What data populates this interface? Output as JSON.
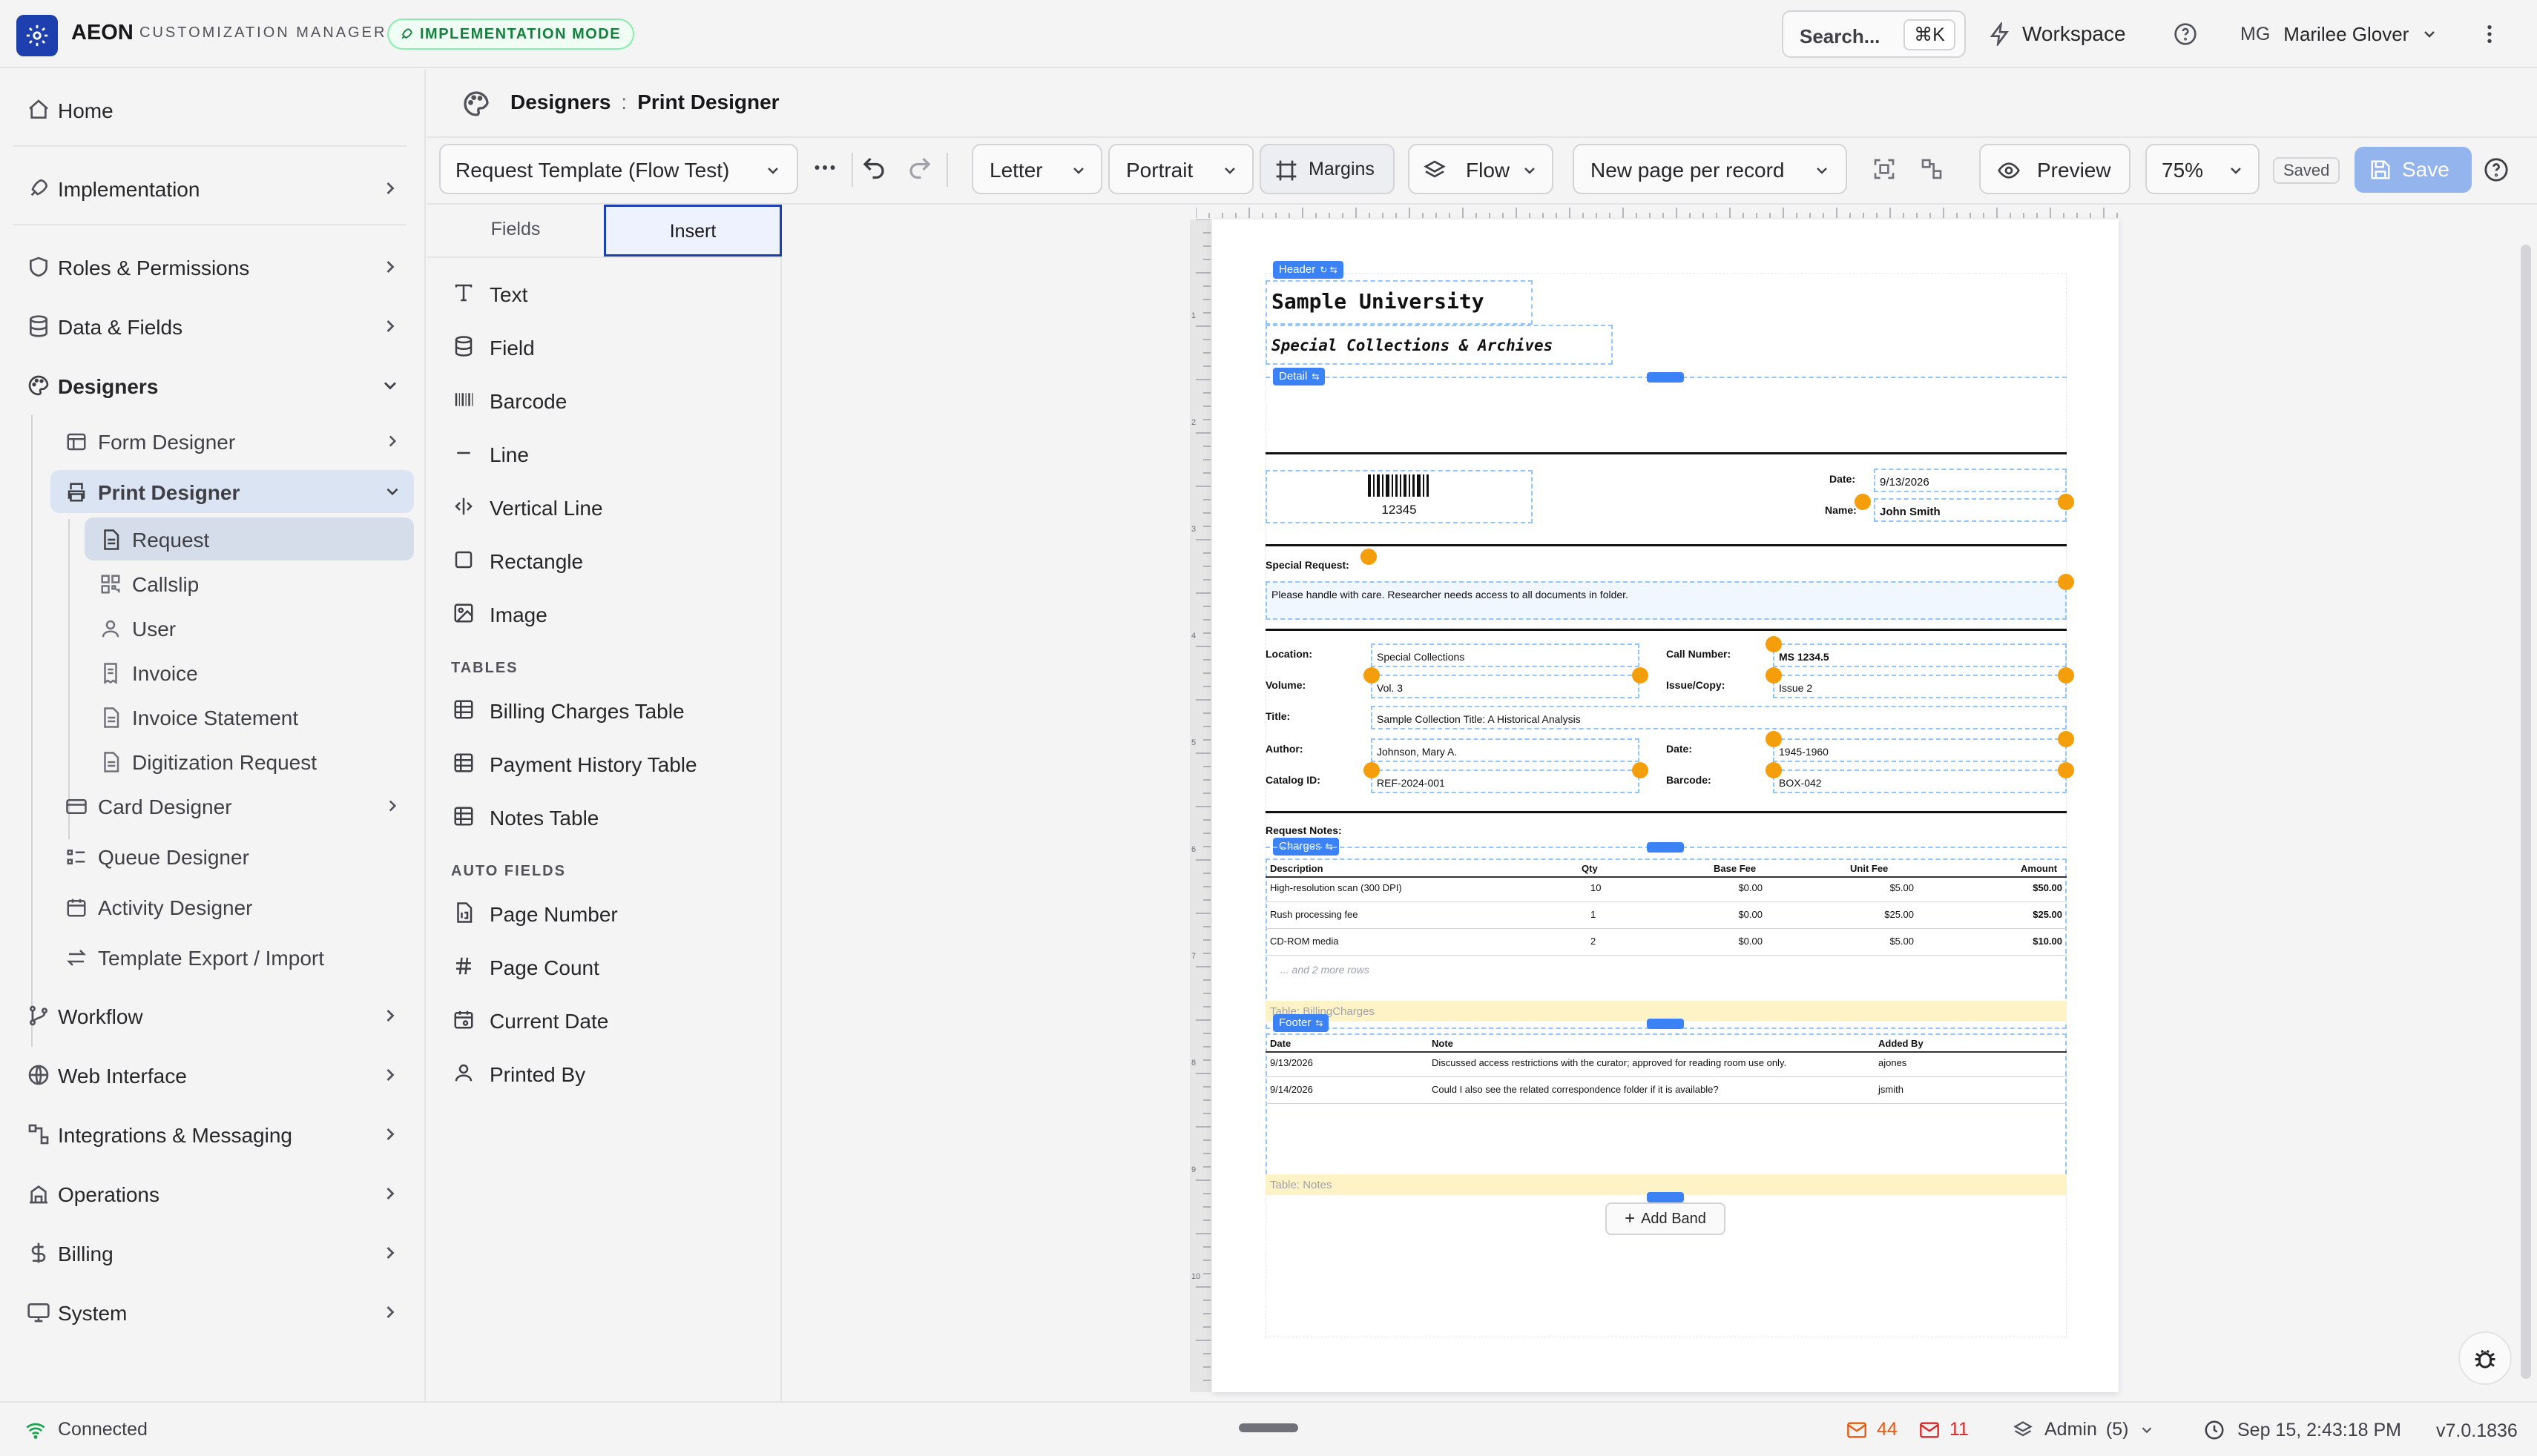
{
  "brand": {
    "name": "AEON",
    "subtitle": "CUSTOMIZATION MANAGER",
    "mode_badge": "IMPLEMENTATION MODE"
  },
  "topbar": {
    "search_label": "Search...",
    "search_shortcut": "⌘K",
    "workspace_label": "Workspace",
    "user_initials": "MG",
    "user_name": "Marilee Glover"
  },
  "sidebar": {
    "home": "Home",
    "implementation": "Implementation",
    "roles": "Roles & Permissions",
    "data_fields": "Data & Fields",
    "designers": "Designers",
    "form_designer": "Form Designer",
    "print_designer": "Print Designer",
    "print_items": [
      "Request",
      "Callslip",
      "User",
      "Invoice",
      "Invoice Statement",
      "Digitization Request"
    ],
    "card_designer": "Card Designer",
    "queue_designer": "Queue Designer",
    "activity_designer": "Activity Designer",
    "template_export": "Template Export / Import",
    "workflow": "Workflow",
    "web_interface": "Web Interface",
    "integrations": "Integrations & Messaging",
    "operations": "Operations",
    "billing": "Billing",
    "system": "System"
  },
  "breadcrumb": {
    "section": "Designers",
    "separator": ":",
    "page": "Print Designer"
  },
  "toolbar": {
    "template": "Request Template (Flow Test)",
    "paper": "Letter",
    "orientation": "Portrait",
    "margins": "Margins",
    "layout": "Flow",
    "paging": "New page per record",
    "preview": "Preview",
    "zoom": "75%",
    "saved_badge": "Saved",
    "save": "Save"
  },
  "panel": {
    "tabs": [
      "Fields",
      "Insert"
    ],
    "active_tab": "Insert",
    "basic_items": [
      "Text",
      "Field",
      "Barcode",
      "Line",
      "Vertical Line",
      "Rectangle",
      "Image"
    ],
    "tables_heading": "TABLES",
    "table_items": [
      "Billing Charges Table",
      "Payment History Table",
      "Notes Table"
    ],
    "auto_heading": "AUTO FIELDS",
    "auto_items": [
      "Page Number",
      "Page Count",
      "Current Date",
      "Printed By"
    ]
  },
  "ruler": {
    "marks": [
      "1",
      "2",
      "3",
      "4",
      "5",
      "6",
      "7",
      "8",
      "9",
      "10"
    ]
  },
  "document": {
    "bands": {
      "header": "Header",
      "detail": "Detail",
      "charges": "Charges",
      "footer": "Footer"
    },
    "title": "Sample University",
    "subtitle": "Special Collections & Archives",
    "barcode_value": "12345",
    "date_label": "Date:",
    "date_value": "9/13/2026",
    "name_label": "Name:",
    "name_value": "John Smith",
    "special_request_label": "Special Request:",
    "special_request_value": "Please handle with care. Researcher needs access to all documents in folder.",
    "fields": {
      "location_label": "Location:",
      "location_value": "Special Collections",
      "volume_label": "Volume:",
      "volume_value": "Vol. 3",
      "title_label": "Title:",
      "title_value": "Sample Collection Title: A Historical Analysis",
      "author_label": "Author:",
      "author_value": "Johnson, Mary A.",
      "catalog_label": "Catalog ID:",
      "catalog_value": "REF-2024-001",
      "call_label": "Call Number:",
      "call_value": "MS 1234.5",
      "issue_label": "Issue/Copy:",
      "issue_value": "Issue 2",
      "date2_label": "Date:",
      "date2_value": "1945-1960",
      "barcode_label": "Barcode:",
      "barcode_value": "BOX-042"
    },
    "request_notes_label": "Request Notes:",
    "charges": {
      "headers": [
        "Description",
        "Qty",
        "Base Fee",
        "Unit Fee",
        "Amount"
      ],
      "rows": [
        [
          "High-resolution scan (300 DPI)",
          "10",
          "$0.00",
          "$5.00",
          "$50.00"
        ],
        [
          "Rush processing fee",
          "1",
          "$0.00",
          "$25.00",
          "$25.00"
        ],
        [
          "CD-ROM media",
          "2",
          "$0.00",
          "$5.00",
          "$10.00"
        ]
      ],
      "more_rows": "... and 2 more rows",
      "table_tag": "Table: BillingCharges"
    },
    "notes": {
      "headers": [
        "Date",
        "Note",
        "Added By"
      ],
      "rows": [
        [
          "9/13/2026",
          "Discussed access restrictions with the curator; approved for reading room use only.",
          "ajones"
        ],
        [
          "9/14/2026",
          "Could I also see the related correspondence folder if it is available?",
          "jsmith"
        ]
      ],
      "table_tag": "Table: Notes"
    },
    "add_band": "Add Band"
  },
  "statusbar": {
    "connection": "Connected",
    "mail_count_1": "44",
    "mail_count_2": "11",
    "role": "Admin",
    "role_count": "(5)",
    "datetime": "Sep 15, 2:43:18 PM",
    "version": "v7.0.1836"
  },
  "colors": {
    "accent": "#1e3fae",
    "band_blue": "#3b82f6",
    "handle_orange": "#f59e0b",
    "save_blue": "#93b4ec",
    "table_tag_bg": "#fef3c7"
  }
}
